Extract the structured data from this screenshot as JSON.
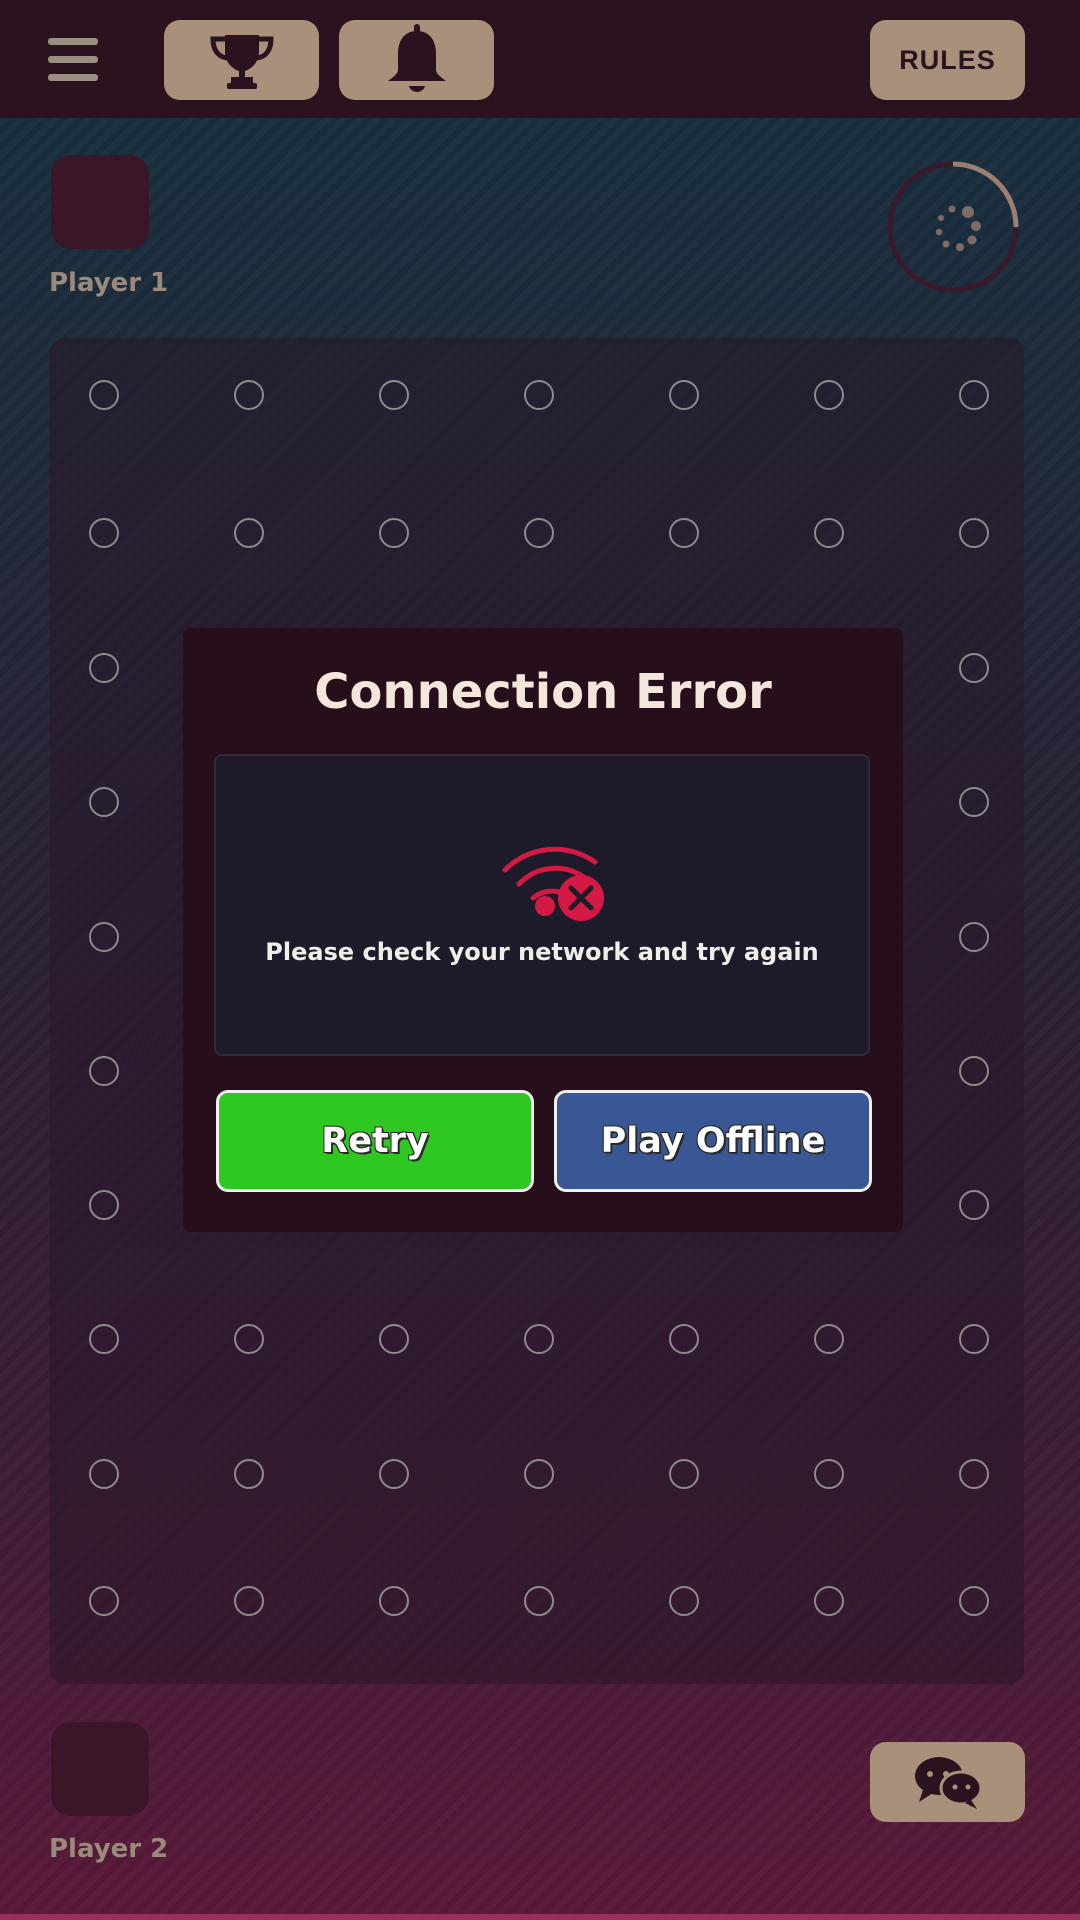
{
  "header": {
    "menu_icon": "hamburger-icon",
    "trophy_icon": "trophy-icon",
    "bell_icon": "bell-icon",
    "rules_label": "RULES"
  },
  "players": {
    "top": {
      "name": "Player 1"
    },
    "bottom": {
      "name": "Player 2"
    }
  },
  "timer": {
    "icon": "loading-spinner-icon"
  },
  "board": {
    "rows": 10,
    "cols": 7,
    "hole_icon": "empty-hole"
  },
  "dialog": {
    "title": "Connection Error",
    "icon": "wifi-error-icon",
    "message": "Please check your network and try again",
    "retry_label": "Retry",
    "offline_label": "Play Offline"
  },
  "chat": {
    "icon": "chat-bubbles-icon"
  },
  "colors": {
    "error_red": "#d41a44",
    "retry_green": "#2fc722",
    "offline_blue": "#3a5795",
    "button_tan": "#a8907a",
    "bar_dark": "#2a131f"
  }
}
